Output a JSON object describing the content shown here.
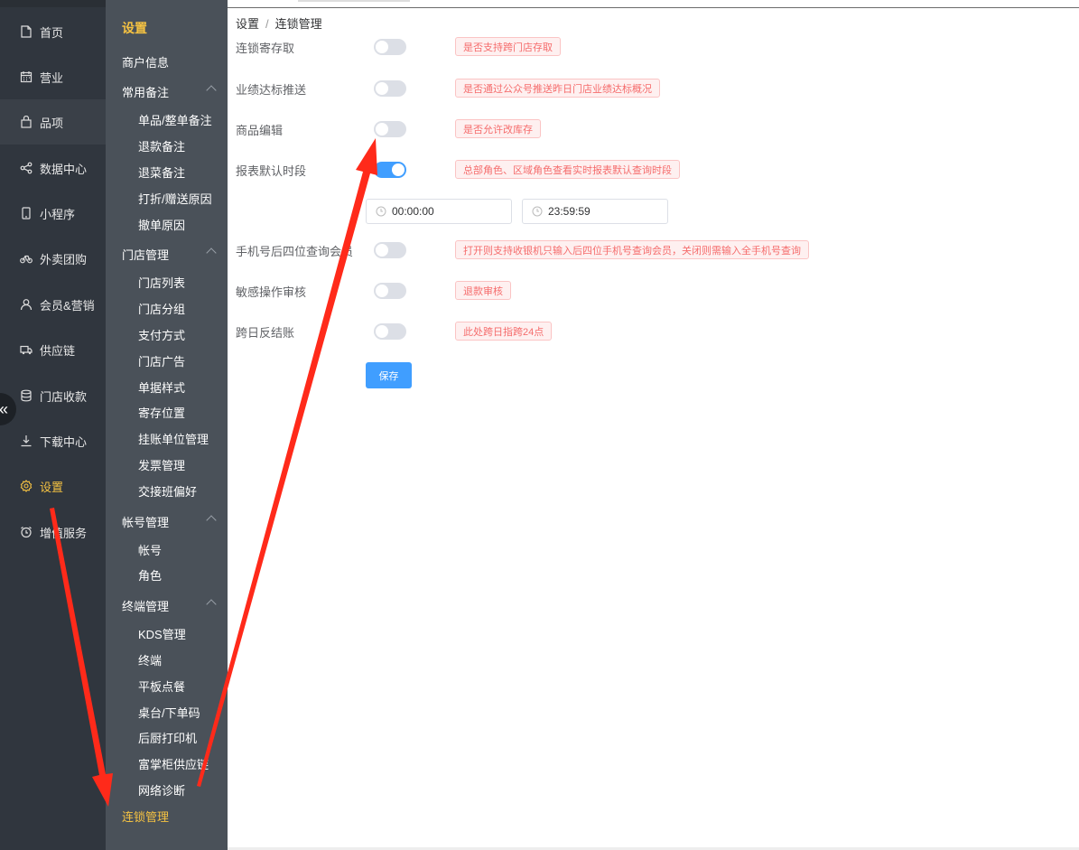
{
  "nav_primary": {
    "items": [
      {
        "label": "首页",
        "icon": "home-icon"
      },
      {
        "label": "营业",
        "icon": "calendar-icon"
      },
      {
        "label": "品项",
        "icon": "bag-icon"
      },
      {
        "label": "数据中心",
        "icon": "share-icon"
      },
      {
        "label": "小程序",
        "icon": "phone-icon"
      },
      {
        "label": "外卖团购",
        "icon": "bike-icon"
      },
      {
        "label": "会员&营销",
        "icon": "user-icon"
      },
      {
        "label": "供应链",
        "icon": "truck-icon"
      },
      {
        "label": "门店收款",
        "icon": "database-icon"
      },
      {
        "label": "下载中心",
        "icon": "download-icon"
      },
      {
        "label": "设置",
        "icon": "gear-icon"
      },
      {
        "label": "增值服务",
        "icon": "alarm-icon"
      }
    ],
    "collapse_glyph": "«"
  },
  "nav_secondary": {
    "title": "设置",
    "merchant_info": "商户信息",
    "remarks": {
      "label": "常用备注",
      "items": [
        "单品/整单备注",
        "退款备注",
        "退菜备注",
        "打折/赠送原因",
        "撤单原因"
      ]
    },
    "store": {
      "label": "门店管理",
      "items": [
        "门店列表",
        "门店分组",
        "支付方式",
        "门店广告",
        "单据样式",
        "寄存位置",
        "挂账单位管理",
        "发票管理",
        "交接班偏好"
      ]
    },
    "account": {
      "label": "帐号管理",
      "items": [
        "帐号",
        "角色"
      ]
    },
    "terminal": {
      "label": "终端管理",
      "items": [
        "KDS管理",
        "终端",
        "平板点餐",
        "桌台/下单码",
        "后厨打印机",
        "富掌柜供应链",
        "网络诊断"
      ]
    },
    "chain": "连锁管理"
  },
  "breadcrumb": {
    "root": "设置",
    "sep": "/",
    "current": "连锁管理"
  },
  "form": {
    "rows": [
      {
        "label": "连锁寄存取",
        "on": false,
        "tip": "是否支持跨门店存取"
      },
      {
        "label": "业绩达标推送",
        "on": false,
        "tip": "是否通过公众号推送昨日门店业绩达标概况"
      },
      {
        "label": "商品编辑",
        "on": false,
        "tip": "是否允许改库存"
      },
      {
        "label": "报表默认时段",
        "on": true,
        "tip": "总部角色、区域角色查看实时报表默认查询时段"
      },
      {
        "label": "手机号后四位查询会员",
        "on": false,
        "tip": "打开则支持收银机只输入后四位手机号查询会员，关闭则需输入全手机号查询"
      },
      {
        "label": "敏感操作审核",
        "on": false,
        "tip": "退款审核"
      },
      {
        "label": "跨日反结账",
        "on": false,
        "tip": "此处跨日指跨24点"
      }
    ],
    "start_time": "00:00:00",
    "end_time": "23:59:59",
    "save_label": "保存"
  },
  "colors": {
    "accent": "#409eff",
    "active_nav": "#f5c242",
    "annotation": "#ff2a1a"
  }
}
